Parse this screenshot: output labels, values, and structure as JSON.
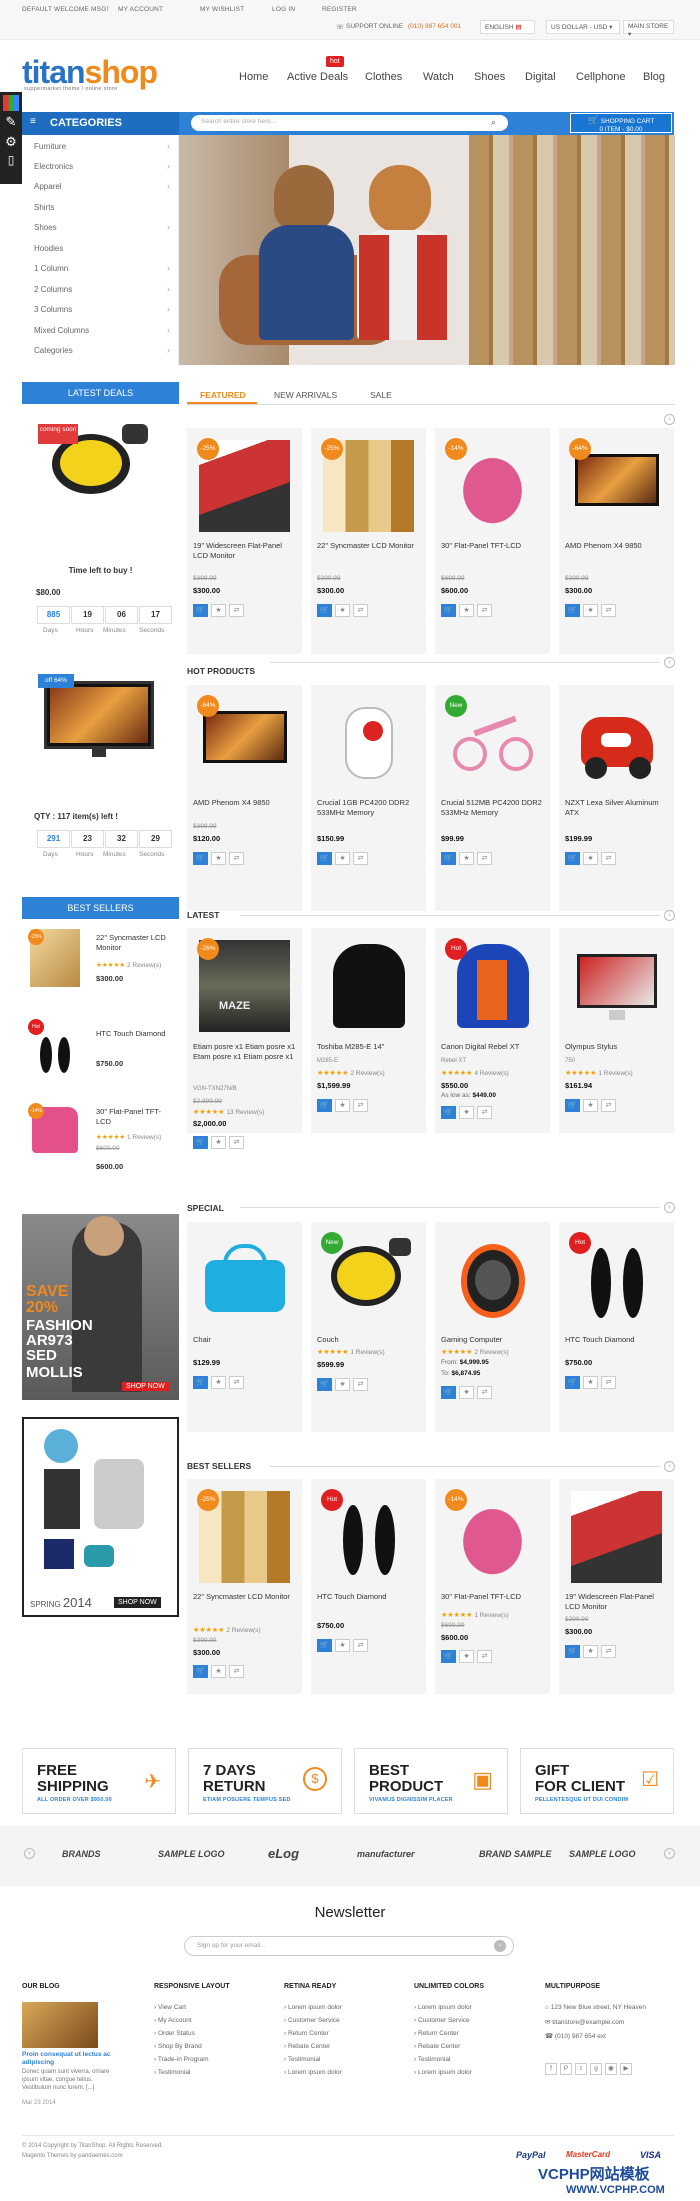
{
  "topbar": {
    "welcome": "DEFAULT WELCOME MSG!",
    "my_account": "MY ACCOUNT",
    "wishlist": "MY WISHLIST",
    "login": "LOG IN",
    "register": "REGISTER",
    "support": "SUPPORT ONLINE",
    "phone": "(010) 987 654 001",
    "lang": "ENGLISH",
    "currency": "US DOLLAR - USD",
    "store": "MAIN STORE"
  },
  "logo": {
    "a": "titan",
    "b": "shop",
    "tagline": "suppermarket theme / online store"
  },
  "nav": {
    "home": "Home",
    "active": "Active Deals",
    "clothes": "Clothes",
    "watch": "Watch",
    "shoes": "Shoes",
    "digital": "Digital",
    "cellphone": "Cellphone",
    "blog": "Blog",
    "hot": "hot"
  },
  "categories": {
    "title": "CATEGORIES",
    "items": [
      "Furniture",
      "Electronics",
      "Apparel",
      "Shirts",
      "Shoes",
      "Hoodies",
      "1 Column",
      "2 Columns",
      "3 Columns",
      "Mixed Columns",
      "Categories"
    ]
  },
  "search": {
    "placeholder": "Search entire store here..."
  },
  "cart": {
    "label": "SHOPPING CART",
    "sub": "0 ITEM - $0.00"
  },
  "tabs": {
    "featured": "FEATURED",
    "new": "NEW ARRIVALS",
    "sale": "SALE"
  },
  "deals": {
    "title": "LATEST DEALS",
    "deal1": {
      "badge": "coming soon",
      "time_label": "Time left to buy !",
      "price": "$80.00",
      "cd": [
        "885",
        "19",
        "06",
        "17"
      ]
    },
    "deal2": {
      "badge": "off 64%",
      "qty": "QTY : 117 item(s) left !",
      "cd": [
        "291",
        "23",
        "32",
        "29"
      ]
    },
    "units": [
      "Days",
      "Hours",
      "Minutes",
      "Seconds"
    ]
  },
  "left_best": {
    "title": "BEST SELLERS",
    "items": [
      {
        "name": "22\" Syncmaster LCD Monitor",
        "rev": "2 Review(s)",
        "price": "$300.00",
        "badge": "-25%"
      },
      {
        "name": "HTC Touch Diamond",
        "price": "$750.00",
        "badge": "Hot"
      },
      {
        "name": "30\" Flat-Panel TFT-LCD",
        "rev": "1 Review(s)",
        "old": "$600.00",
        "price": "$600.00",
        "badge": "-14%"
      }
    ]
  },
  "promo": {
    "save": "SAVE",
    "pct": "20%",
    "fashion": "FASHION",
    "code": "AR973",
    "sed": "SED",
    "mollis": "MOLLIS",
    "shop": "SHOP NOW",
    "spring": "SPRING",
    "year": "2014",
    "shop2": "SHOP NOW"
  },
  "featured": [
    {
      "name": "19\" Widescreen Flat-Panel LCD Monitor",
      "old": "$399.99",
      "price": "$300.00",
      "badge": "-25%"
    },
    {
      "name": "22\" Syncmaster LCD Monitor",
      "old": "$399.99",
      "price": "$300.00",
      "badge": "-25%"
    },
    {
      "name": "30\" Flat-Panel TFT-LCD",
      "old": "$699.99",
      "price": "$600.00",
      "badge": "-14%"
    },
    {
      "name": "AMD Phenom X4 9850",
      "old": "$399.99",
      "price": "$300.00",
      "badge": "-64%"
    }
  ],
  "hot": {
    "title": "HOT PRODUCTS",
    "items": [
      {
        "name": "AMD Phenom X4 9850",
        "old": "$399.99",
        "price": "$120.00",
        "badge": "-64%"
      },
      {
        "name": "Crucial 1GB PC4200 DDR2 533MHz Memory",
        "price": "$150.99"
      },
      {
        "name": "Crucial 512MB PC4200 DDR2 533MHz Memory",
        "price": "$99.99",
        "badge": "New"
      },
      {
        "name": "NZXT Lexa Silver Aluminum ATX",
        "price": "$199.99"
      }
    ]
  },
  "latest": {
    "title": "LATEST",
    "items": [
      {
        "name": "Etiam posre x1 Etiam posre x1 Etam posre x1 Etiam posre x1",
        "sku": "VGN-TXN27N/B",
        "old": "$2,899.99",
        "rev": "13 Review(s)",
        "price": "$2,000.00",
        "badge": "-26%"
      },
      {
        "name": "Toshiba M285-E 14\"",
        "sku": "M285-E",
        "rev": "2 Review(s)",
        "price": "$1,599.99"
      },
      {
        "name": "Canon Digital Rebel XT",
        "sku": "Rebel XT",
        "rev": "4 Review(s)",
        "price": "$550.00",
        "aslow": "As low as:",
        "low": "$449.00",
        "badge": "Hot"
      },
      {
        "name": "Olympus Stylus",
        "sku": "750",
        "rev": "1 Review(s)",
        "price": "$161.94"
      }
    ]
  },
  "special": {
    "title": "SPECIAL",
    "items": [
      {
        "name": "Chair",
        "price": "$129.99"
      },
      {
        "name": "Couch",
        "rev": "1 Review(s)",
        "price": "$599.99",
        "badge": "New"
      },
      {
        "name": "Gaming Computer",
        "rev": "2 Review(s)",
        "from": "From:",
        "fromv": "$4,999.95",
        "to": "To:",
        "tov": "$6,874.95"
      },
      {
        "name": "HTC Touch Diamond",
        "price": "$750.00",
        "badge": "Hot"
      }
    ]
  },
  "best": {
    "title": "BEST SELLERS",
    "items": [
      {
        "name": "22\" Syncmaster LCD Monitor",
        "rev": "2 Review(s)",
        "old": "$399.99",
        "price": "$300.00",
        "badge": "-25%"
      },
      {
        "name": "HTC Touch Diamond",
        "price": "$750.00",
        "badge": "Hot"
      },
      {
        "name": "30\" Flat-Panel TFT-LCD",
        "rev": "1 Review(s)",
        "old": "$699.99",
        "price": "$600.00",
        "badge": "-14%"
      },
      {
        "name": "19\" Widescreen Flat-Panel LCD Monitor",
        "old": "$399.99",
        "price": "$300.00",
        "badge": "-25%"
      }
    ]
  },
  "features": [
    {
      "t1": "FREE",
      "t2": "SHIPPING",
      "sub": "ALL ORDER OVER $950.00"
    },
    {
      "t1": "7 DAYS",
      "t2": "RETURN",
      "sub": "ETIAM POSUERE TEMPUS SED"
    },
    {
      "t1": "BEST",
      "t2": "PRODUCT",
      "sub": "VIVAMUS DIGNISSIM PLACER"
    },
    {
      "t1": "GIFT",
      "t2": "FOR CLIENT",
      "sub": "PELLENTESQUE UT DUI CONDIM"
    }
  ],
  "brands": [
    "BRANDS",
    "SAMPLE LOGO",
    "eLog",
    "manufacturer",
    "BRAND SAMPLE",
    "SAMPLE LOGO"
  ],
  "newsletter": {
    "title": "Newsletter",
    "placeholder": "Sign up for your email..."
  },
  "footer": {
    "blog": {
      "title": "OUR BLOG",
      "post": "Proin consequat ut lectus ac adipiscing",
      "text": "Donec quam sunt viverra, ornare ipsum vitae, congue tellus. Vestibulum nunc lorem. [...]",
      "date": "Mar 23 2014"
    },
    "cols": [
      {
        "title": "RESPONSIVE LAYOUT",
        "links": [
          "View Cart",
          "My Account",
          "Order Status",
          "Shop By Brand",
          "Trade-in Program",
          "Testimonial"
        ]
      },
      {
        "title": "RETINA READY",
        "links": [
          "Lorem ipsum dolor",
          "Customer Service",
          "Return Center",
          "Rebate Center",
          "Testimonial",
          "Lorem ipsum dolor"
        ]
      },
      {
        "title": "UNLIMITED COLORS",
        "links": [
          "Lorem ipsum dolor",
          "Customer Service",
          "Return Center",
          "Rebate Center",
          "Testimonial",
          "Lorem ipsum dolor"
        ]
      }
    ],
    "multi": {
      "title": "MULTIPURPOSE",
      "address": "123 New Blue street, NY Heaven",
      "email": "titanstore@example.com",
      "phone": "(010) 987 654 ext"
    }
  },
  "copyright": {
    "line1": "© 2014 Copyright by TitanShop. All Rights Reserved.",
    "line2": "Magento Themes by pandaemes.com"
  },
  "payments": [
    "PayPal",
    "MasterCard",
    "VISA"
  ],
  "watermark": {
    "t1": "VCPHP网站模板",
    "t2": "WWW.VCPHP.COM"
  }
}
